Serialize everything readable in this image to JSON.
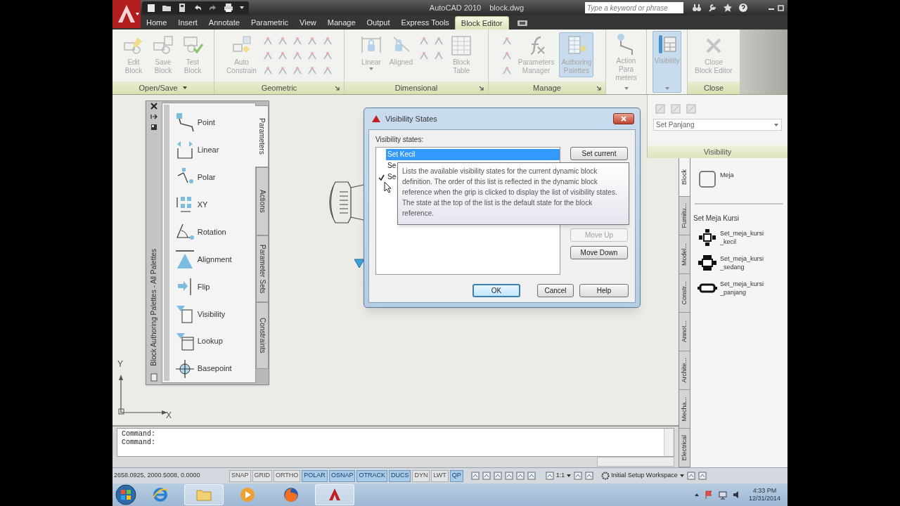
{
  "title_bar": {
    "app_title": "AutoCAD 2010",
    "file_name": "block.dwg",
    "search": {
      "placeholder": "Type a keyword or phrase"
    }
  },
  "ribbon_tabs": [
    {
      "label": "Home",
      "selected": false
    },
    {
      "label": "Insert",
      "selected": false
    },
    {
      "label": "Annotate",
      "selected": false
    },
    {
      "label": "Parametric",
      "selected": false
    },
    {
      "label": "View",
      "selected": false
    },
    {
      "label": "Manage",
      "selected": false
    },
    {
      "label": "Output",
      "selected": false
    },
    {
      "label": "Express Tools",
      "selected": false
    },
    {
      "label": "Block Editor",
      "selected": true
    }
  ],
  "ribbon_panels": [
    {
      "label": "Open/Save",
      "menu": true,
      "launcher": false,
      "tools": [
        {
          "kind": "large",
          "lines": [
            "Edit",
            "Block"
          ],
          "active": false,
          "dropdown": false
        },
        {
          "kind": "large",
          "lines": [
            "Save",
            "Block"
          ],
          "active": false,
          "dropdown": false
        },
        {
          "kind": "large",
          "lines": [
            "Test",
            "Block"
          ],
          "active": false,
          "dropdown": false
        }
      ]
    },
    {
      "label": "Geometric",
      "menu": false,
      "launcher": true,
      "tools": [
        {
          "kind": "large",
          "lines": [
            "Auto",
            "Constrain"
          ],
          "active": false,
          "dropdown": false
        },
        {
          "kind": "geometric_icons"
        },
        {
          "kind": "show_icons"
        }
      ]
    },
    {
      "label": "Dimensional",
      "menu": false,
      "launcher": true,
      "tools": [
        {
          "kind": "large",
          "lines": [
            "Linear"
          ],
          "active": false,
          "dropdown": true
        },
        {
          "kind": "large",
          "lines": [
            "Aligned"
          ],
          "active": false,
          "dropdown": false
        },
        {
          "kind": "dimensional_icons"
        },
        {
          "kind": "large",
          "lines": [
            "Block",
            "Table"
          ],
          "active": false,
          "dropdown": false
        }
      ]
    },
    {
      "label": "Manage",
      "menu": false,
      "launcher": true,
      "tools": [
        {
          "kind": "manage_icons"
        },
        {
          "kind": "large",
          "lines": [
            "Parameters",
            "Manager"
          ],
          "active": false,
          "dropdown": false
        },
        {
          "kind": "large",
          "lines": [
            "Authoring",
            "Palettes"
          ],
          "active": true,
          "dropdown": false
        }
      ]
    },
    {
      "tools": [
        {
          "kind": "large",
          "lines": [
            "Action",
            "Para",
            "meters"
          ],
          "active": false,
          "dropdown": true
        }
      ]
    },
    {
      "tools": [
        {
          "kind": "large",
          "lines": [
            "Visibility"
          ],
          "active": true,
          "dropdown": true
        }
      ]
    },
    {
      "label": "Close",
      "menu": false,
      "launcher": false,
      "tools": [
        {
          "kind": "large",
          "lines": [
            "Close",
            "Block Editor"
          ],
          "active": false,
          "dropdown": false
        }
      ]
    }
  ],
  "visibility_panel": {
    "current_state": "Set Panjang",
    "label": "Visibility"
  },
  "authoring_palette": {
    "title": "Block Authoring Palettes - All Palettes",
    "items": [
      {
        "kind": "point",
        "label": "Point"
      },
      {
        "kind": "linear",
        "label": "Linear"
      },
      {
        "kind": "polar",
        "label": "Polar"
      },
      {
        "kind": "xy",
        "label": "XY"
      },
      {
        "kind": "rotation",
        "label": "Rotation"
      },
      {
        "kind": "alignment",
        "label": "Alignment"
      },
      {
        "kind": "flip",
        "label": "Flip"
      },
      {
        "kind": "visibility",
        "label": "Visibility"
      },
      {
        "kind": "lookup",
        "label": "Lookup"
      },
      {
        "kind": "basepoint",
        "label": "Basepoint"
      }
    ],
    "tabs": [
      {
        "label": "Parameters",
        "selected": true
      },
      {
        "label": "Actions",
        "selected": false
      },
      {
        "label": "Parameter Sets",
        "selected": false
      },
      {
        "label": "Constraints",
        "selected": false
      }
    ]
  },
  "dialog": {
    "title": "Visibility States",
    "list_label": "Visibility states:",
    "states": [
      {
        "name": "Set Kecil",
        "selected": true,
        "current": false
      },
      {
        "name": "Se",
        "selected": false,
        "current": false
      },
      {
        "name": "Se",
        "selected": false,
        "current": true
      }
    ],
    "tooltip": "Lists the available visibility states for the current dynamic block definition. The order of this list is reflected in the dynamic block reference when the grip is clicked to display the list of visibility states. The state at the top of the list is the default state for the block reference.",
    "side_buttons": [
      {
        "label": "Set current",
        "disabled": false
      },
      {
        "label": "Move Up",
        "disabled": true
      },
      {
        "label": "Move Down",
        "disabled": false
      }
    ],
    "footer_buttons": [
      {
        "label": "OK",
        "default": true
      },
      {
        "label": "Cancel",
        "default": false
      },
      {
        "label": "Help",
        "default": false
      }
    ]
  },
  "ucs": {
    "x_label": "X",
    "y_label": "Y"
  },
  "tool_palette": {
    "tabs": [
      {
        "label": "Block",
        "selected": true
      },
      {
        "label": "Furnitu...",
        "selected": false
      },
      {
        "label": "Model...",
        "selected": false
      },
      {
        "label": "Constr...",
        "selected": false
      },
      {
        "label": "Annot...",
        "selected": false
      },
      {
        "label": "Archite...",
        "selected": false
      },
      {
        "label": "Mecha...",
        "selected": false
      },
      {
        "label": "Electrical",
        "selected": false
      }
    ],
    "sections": [
      {
        "tools": [
          {
            "lines": [
              "Meja"
            ]
          }
        ]
      },
      {
        "heading": "Set Meja Kursi",
        "tools": [
          {
            "lines": [
              "Set_meja_kursi",
              "_kecil"
            ]
          },
          {
            "lines": [
              "Set_meja_kursi",
              "_sedang"
            ]
          },
          {
            "lines": [
              "Set_meja_kursi",
              "_panjang"
            ]
          }
        ]
      }
    ]
  },
  "command_line": [
    "Command:",
    "Command:"
  ],
  "status_bar": {
    "coordinates": "2658.0925, 2000.5008, 0.0000",
    "toggles": [
      {
        "label": "SNAP",
        "on": false
      },
      {
        "label": "GRID",
        "on": false
      },
      {
        "label": "ORTHO",
        "on": false
      },
      {
        "label": "POLAR",
        "on": true
      },
      {
        "label": "OSNAP",
        "on": true
      },
      {
        "label": "OTRACK",
        "on": true
      },
      {
        "label": "DUCS",
        "on": true
      },
      {
        "label": "DYN",
        "on": false
      },
      {
        "label": "LWT",
        "on": false
      },
      {
        "label": "QP",
        "on": true
      }
    ],
    "scale": "1:1",
    "workspace": "Initial Setup Workspace"
  },
  "taskbar": {
    "apps": [
      {
        "kind": "ie",
        "active": false
      },
      {
        "kind": "folder",
        "active": true
      },
      {
        "kind": "media",
        "active": false
      },
      {
        "kind": "firefox",
        "active": false
      },
      {
        "kind": "autocad",
        "active": true
      }
    ],
    "time": "4:33 PM",
    "date": "12/31/2014"
  }
}
